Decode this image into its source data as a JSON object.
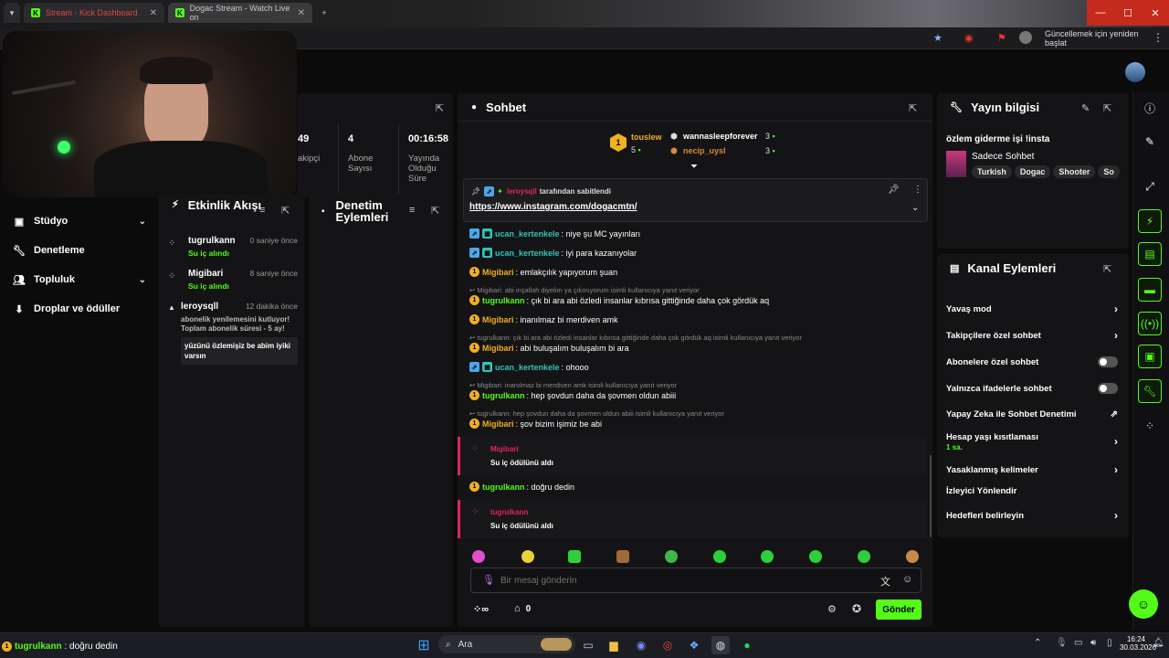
{
  "browser": {
    "tabs": [
      {
        "title": "Stream - Kick Dashboard"
      },
      {
        "title": "Dogac Stream - Watch Live on"
      }
    ],
    "update_label": "Güncellemek için yeniden başlat"
  },
  "stats": [
    {
      "value": "49",
      "label": "akipçi"
    },
    {
      "value": "4",
      "label": "Abone Sayısı"
    },
    {
      "value": "00:16:58",
      "label": "Yayında Olduğu Süre"
    }
  ],
  "sidebar": {
    "items": [
      {
        "label": "Stüdyo"
      },
      {
        "label": "Denetleme"
      },
      {
        "label": "Topluluk"
      },
      {
        "label": "Droplar ve ödüller"
      }
    ]
  },
  "activity": {
    "title": "Etkinlik Akışı",
    "items": [
      {
        "user": "tugrulkann",
        "time": "0 saniye önce",
        "event": "Su iç alındı"
      },
      {
        "user": "Migibari",
        "time": "8 saniye önce",
        "event": "Su iç alındı"
      },
      {
        "user": "leroysqll",
        "time": "12 dakika önce",
        "event": "abonelik yenilemesini kutluyor! Toplam abonelik süresi - 5 ay!",
        "message": "yüzünü özlemişiz be abim iyiki varsın"
      }
    ]
  },
  "moderation": {
    "title": "Denetim Eylemleri"
  },
  "chat": {
    "title": "Sohbet",
    "leaders": [
      {
        "name": "touslew",
        "count": "5"
      },
      {
        "name": "wannasleepforever",
        "count": "3"
      },
      {
        "name": "necip_uysl",
        "count": "3"
      }
    ],
    "pinned": {
      "by": "leroysqll",
      "by_suffix": "tarafından sabitlendi",
      "link": "https://www.instagram.com/dogacmtn/"
    },
    "messages": [
      {
        "user": "ucan_kertenkele",
        "text": "niye şu MC yayınları"
      },
      {
        "user": "ucan_kertenkele",
        "text": "iyi para kazanıyolar"
      },
      {
        "user": "Migibari",
        "text": "emlakçılık yapıyorum şuan"
      },
      {
        "reply": "Migibari: abi inşallah diyelim ya çıkmıyorum isimli kullanıcıya yanıt veriyor",
        "user": "tugrulkann",
        "text": "çık bi ara abi özledi insanlar kıbrısa gittiğinde daha çok gördük aq"
      },
      {
        "user": "Migibari",
        "text": "inanılmaz bi merdiven amk"
      },
      {
        "reply": "tugrulkann: çık bi ara abi özledi insanlar kıbrısa gittiğinde daha çok gördük aq isimli kullanıcıya yanıt veriyor",
        "user": "Migibari",
        "text": "abi buluşalım buluşalım bi ara"
      },
      {
        "user": "ucan_kertenkele",
        "text": "ohooo"
      },
      {
        "reply": "Migibari: inanılmaz bi merdiven amk isimli kullanıcıya yanıt veriyor",
        "user": "tugrulkann",
        "text": "hep şovdun daha da şovmen oldun abiii"
      },
      {
        "reply": "tugrulkann: hep şovdun daha da şovmen oldun abiii isimli kullanıcıya yanıt veriyor",
        "user": "Migibari",
        "text": "şov bizim işimiz be abi"
      }
    ],
    "rewards": [
      {
        "user": "Migibari",
        "text": "Su iç ödülünü aldı"
      },
      {
        "user": "tugrulkann",
        "text": "Su iç ödülünü aldı"
      }
    ],
    "last_message": {
      "user": "tugrulkann",
      "text": "doğru dedin"
    },
    "placeholder": "Bir mesaj gönderin",
    "points": "0",
    "send_label": "Gönder"
  },
  "stream_info": {
    "title": "Yayın bilgisi",
    "stream_title": "özlem giderme işi !insta",
    "category": "Sadece Sohbet",
    "tags": [
      "Turkish",
      "Dogac",
      "Shooter",
      "So"
    ]
  },
  "channel_actions": {
    "title": "Kanal Eylemleri",
    "items": [
      {
        "label": "Yavaş mod"
      },
      {
        "label": "Takipçilere özel sohbet"
      },
      {
        "label": "Abonelere özel sohbet"
      },
      {
        "label": "Yalnızca ifadelerle sohbet"
      },
      {
        "label": "Yapay Zeka ile Sohbet Denetimi"
      },
      {
        "label": "Hesap yaşı kısıtlaması",
        "sub": "1 sa."
      },
      {
        "label": "Yasaklanmış kelimeler"
      },
      {
        "label": "İzleyici Yönlendir"
      },
      {
        "label": "Hedefleri belirleyin"
      }
    ]
  },
  "taskbar": {
    "search": "Ara",
    "time": "16:24",
    "date": "30.03.2026"
  },
  "colors": {
    "accent": "#53fc18",
    "reward": "#e0245e",
    "bg": "#0b0b0c",
    "panel": "#141416"
  }
}
